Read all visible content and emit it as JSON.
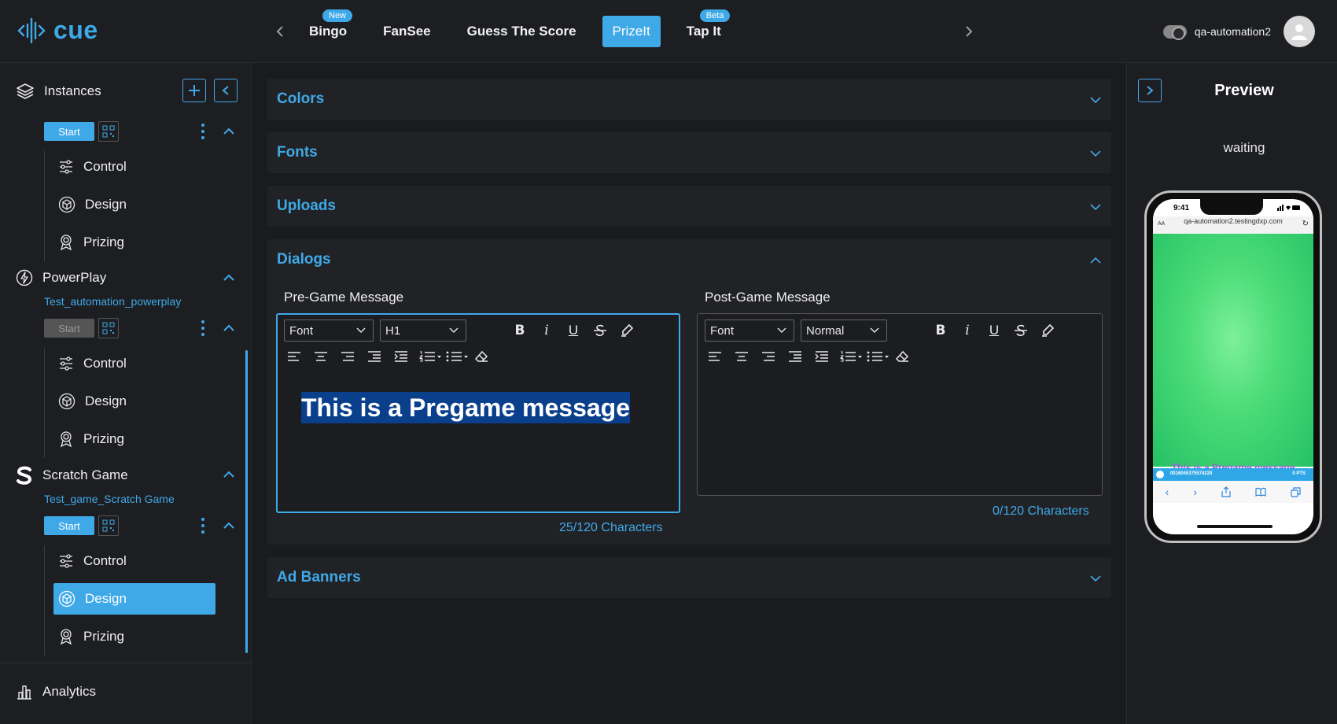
{
  "app": {
    "logo_text": "cue",
    "brand_color": "#3fa9e8"
  },
  "tabs": [
    {
      "label": "Bingo",
      "badge": "New"
    },
    {
      "label": "FanSee",
      "badge": ""
    },
    {
      "label": "Guess The Score",
      "badge": ""
    },
    {
      "label": "PrizeIt",
      "badge": "",
      "active": true
    },
    {
      "label": "Tap It",
      "badge": "Beta"
    }
  ],
  "user": {
    "name": "qa-automation2"
  },
  "sidebar": {
    "instances_label": "Instances",
    "groups": [
      {
        "title": "",
        "subtitle": "",
        "start_label": "Start",
        "items": [
          "Control",
          "Design",
          "Prizing"
        ]
      },
      {
        "title": "PowerPlay",
        "subtitle": "Test_automation_powerplay",
        "start_label": "Start",
        "items": [
          "Control",
          "Design",
          "Prizing"
        ]
      },
      {
        "title": "Scratch Game",
        "subtitle": "Test_game_Scratch Game",
        "start_label": "Start",
        "items": [
          "Control",
          "Design",
          "Prizing"
        ],
        "active_item": "Design"
      }
    ],
    "analytics_label": "Analytics"
  },
  "sections": {
    "colors": "Colors",
    "fonts": "Fonts",
    "uploads": "Uploads",
    "dialogs": "Dialogs",
    "ad_banners": "Ad Banners"
  },
  "dialogs": {
    "pre": {
      "label": "Pre-Game Message",
      "font": "Font",
      "size": "H1",
      "content": "This is a Pregame message",
      "char_count": "25/120 Characters"
    },
    "post": {
      "label": "Post-Game Message",
      "font": "Font",
      "size": "Normal",
      "content": "",
      "char_count": "0/120 Characters"
    }
  },
  "preview": {
    "title": "Preview",
    "status": "waiting",
    "phone_time": "9:41",
    "phone_aa": "AA",
    "url": "qa-automation2.testingdxp.com",
    "message": "This is a Pregame message",
    "bar_left": "0016045375574220",
    "bar_right": "0 PTS"
  }
}
